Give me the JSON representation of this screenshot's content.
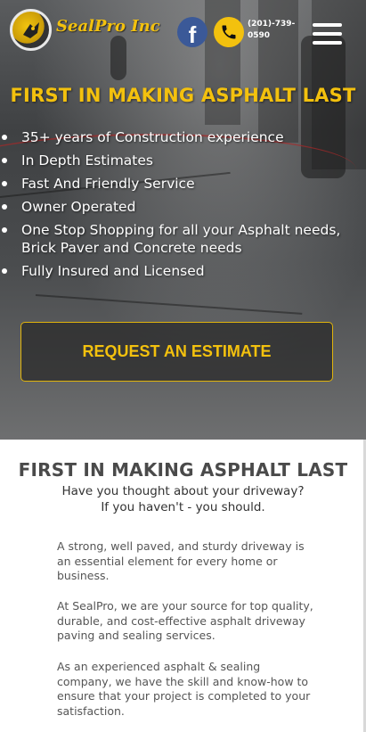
{
  "header": {
    "brand_name": "SealPro Inc",
    "facebook_letter": "f",
    "phone": "(201)-739-0590",
    "icons": {
      "logo": "sealpro-logo-icon",
      "facebook": "facebook-icon",
      "phone": "phone-icon",
      "menu": "hamburger-menu-icon"
    }
  },
  "hero": {
    "title": "FIRST IN MAKING ASPHALT LAST",
    "features": [
      "35+ years of Construction experience",
      "In Depth Estimates",
      "Fast And Friendly Service",
      "Owner Operated",
      "One Stop Shopping for all your Asphalt needs, Brick Paver and Concrete needs",
      "Fully Insured and Licensed"
    ],
    "cta_label": "REQUEST AN ESTIMATE"
  },
  "content": {
    "title": "FIRST IN MAKING ASPHALT LAST",
    "subtitle_line1": "Have you thought about your driveway?",
    "subtitle_line2": "If you haven't - you should.",
    "paragraphs": [
      "A strong, well paved, and sturdy driveway is an essential element for every home or business.",
      "At SealPro, we are your source for top quality, durable, and cost-effective asphalt driveway paving and sealing services.",
      "As an experienced asphalt & sealing company, we have the skill and know-how to ensure that your project is completed to your satisfaction."
    ]
  },
  "colors": {
    "accent_yellow": "#f3c10e",
    "facebook_blue": "#3b5998",
    "text_dark": "#4a4a4a"
  }
}
